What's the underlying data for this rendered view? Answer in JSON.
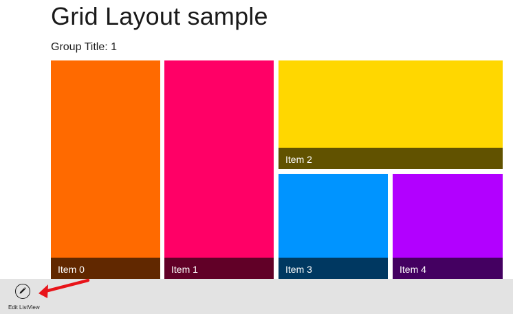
{
  "header": {
    "title": "Grid Layout sample"
  },
  "group": {
    "title": "Group Title: 1"
  },
  "items": [
    {
      "label": "Item 0",
      "color": "#FF6A00"
    },
    {
      "label": "Item 1",
      "color": "#FF0066"
    },
    {
      "label": "Item 2",
      "color": "#FFD700"
    },
    {
      "label": "Item 3",
      "color": "#0094FF"
    },
    {
      "label": "Item 4",
      "color": "#B200FF"
    }
  ],
  "app_bar": {
    "edit_button_label": "Edit ListView",
    "edit_button_icon": "pencil-icon"
  },
  "annotation": {
    "arrow_color": "#E8141A"
  }
}
